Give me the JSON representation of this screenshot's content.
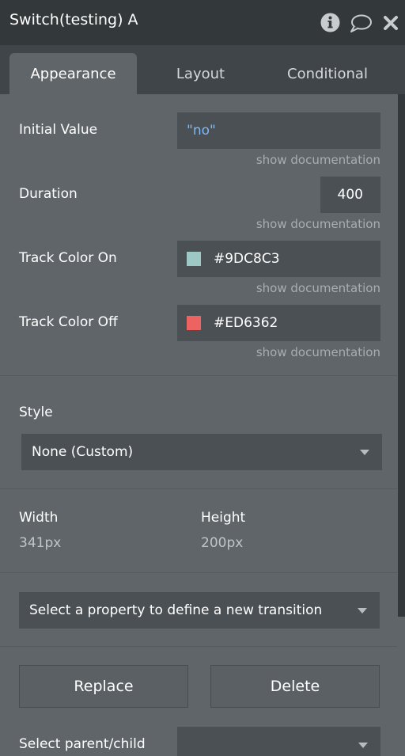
{
  "window": {
    "title": "Switch(testing) A"
  },
  "icons": {
    "info": "info-icon",
    "comment": "comment-bubble-icon",
    "close": "close-icon"
  },
  "tabs": [
    {
      "label": "Appearance",
      "active": true
    },
    {
      "label": "Layout",
      "active": false
    },
    {
      "label": "Conditional",
      "active": false
    }
  ],
  "properties": {
    "initial_value": {
      "label": "Initial Value",
      "value": "\"no\"",
      "doc": "show documentation"
    },
    "duration": {
      "label": "Duration",
      "value": "400",
      "doc": "show documentation"
    },
    "track_on": {
      "label": "Track Color On",
      "value": "#9DC8C3",
      "color": "#9DC8C3",
      "doc": "show documentation"
    },
    "track_off": {
      "label": "Track Color Off",
      "value": "#ED6362",
      "color": "#ED6362",
      "doc": "show documentation"
    }
  },
  "style": {
    "label": "Style",
    "value": "None (Custom)"
  },
  "size": {
    "width_label": "Width",
    "width_value": "341px",
    "height_label": "Height",
    "height_value": "200px"
  },
  "transition": {
    "placeholder": "Select a property to define a new transition"
  },
  "actions": {
    "replace": "Replace",
    "delete": "Delete"
  },
  "parent_child": {
    "label": "Select parent/child",
    "value": ""
  },
  "colors": {
    "titlebar_bg": "#33383B",
    "tabbar_bg": "#3F4549",
    "panel_bg": "#5F6569",
    "field_bg": "#4B5054",
    "value_link": "#7FB8F0"
  }
}
